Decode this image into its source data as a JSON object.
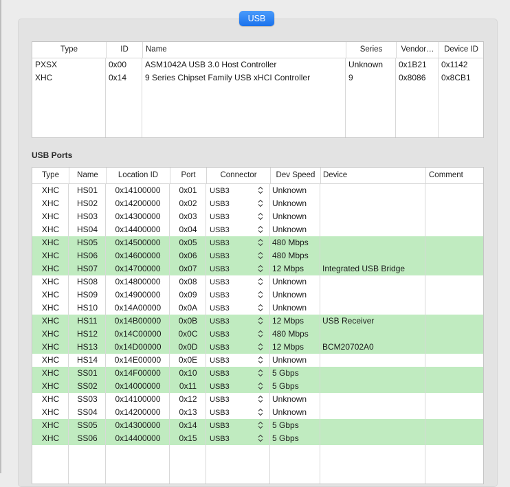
{
  "tab": {
    "label": "USB"
  },
  "controllers": {
    "columns": [
      "Type",
      "ID",
      "Name",
      "Series",
      "Vendor…",
      "Device ID"
    ],
    "rows": [
      {
        "type": "PXSX",
        "id": "0x00",
        "name": "ASM1042A USB 3.0 Host Controller",
        "series": "Unknown",
        "vendor": "0x1B21",
        "device_id": "0x1142"
      },
      {
        "type": "XHC",
        "id": "0x14",
        "name": "9 Series Chipset Family USB xHCI Controller",
        "series": "9",
        "vendor": "0x8086",
        "device_id": "0x8CB1"
      }
    ]
  },
  "ports_label": "USB Ports",
  "ports": {
    "columns": [
      "Type",
      "Name",
      "Location ID",
      "Port",
      "Connector",
      "Dev Speed",
      "Device",
      "Comment"
    ],
    "highlight_color": "#c0ebc0",
    "rows": [
      {
        "type": "XHC",
        "name": "HS01",
        "location": "0x14100000",
        "port": "0x01",
        "connector": "USB3",
        "speed": "Unknown",
        "device": "",
        "comment": "",
        "active": false
      },
      {
        "type": "XHC",
        "name": "HS02",
        "location": "0x14200000",
        "port": "0x02",
        "connector": "USB3",
        "speed": "Unknown",
        "device": "",
        "comment": "",
        "active": false
      },
      {
        "type": "XHC",
        "name": "HS03",
        "location": "0x14300000",
        "port": "0x03",
        "connector": "USB3",
        "speed": "Unknown",
        "device": "",
        "comment": "",
        "active": false
      },
      {
        "type": "XHC",
        "name": "HS04",
        "location": "0x14400000",
        "port": "0x04",
        "connector": "USB3",
        "speed": "Unknown",
        "device": "",
        "comment": "",
        "active": false
      },
      {
        "type": "XHC",
        "name": "HS05",
        "location": "0x14500000",
        "port": "0x05",
        "connector": "USB3",
        "speed": "480 Mbps",
        "device": "",
        "comment": "",
        "active": true
      },
      {
        "type": "XHC",
        "name": "HS06",
        "location": "0x14600000",
        "port": "0x06",
        "connector": "USB3",
        "speed": "480 Mbps",
        "device": "",
        "comment": "",
        "active": true
      },
      {
        "type": "XHC",
        "name": "HS07",
        "location": "0x14700000",
        "port": "0x07",
        "connector": "USB3",
        "speed": "12 Mbps",
        "device": "Integrated USB Bridge",
        "comment": "",
        "active": true
      },
      {
        "type": "XHC",
        "name": "HS08",
        "location": "0x14800000",
        "port": "0x08",
        "connector": "USB3",
        "speed": "Unknown",
        "device": "",
        "comment": "",
        "active": false
      },
      {
        "type": "XHC",
        "name": "HS09",
        "location": "0x14900000",
        "port": "0x09",
        "connector": "USB3",
        "speed": "Unknown",
        "device": "",
        "comment": "",
        "active": false
      },
      {
        "type": "XHC",
        "name": "HS10",
        "location": "0x14A00000",
        "port": "0x0A",
        "connector": "USB3",
        "speed": "Unknown",
        "device": "",
        "comment": "",
        "active": false
      },
      {
        "type": "XHC",
        "name": "HS11",
        "location": "0x14B00000",
        "port": "0x0B",
        "connector": "USB3",
        "speed": "12 Mbps",
        "device": "USB Receiver",
        "comment": "",
        "active": true
      },
      {
        "type": "XHC",
        "name": "HS12",
        "location": "0x14C00000",
        "port": "0x0C",
        "connector": "USB3",
        "speed": "480 Mbps",
        "device": "",
        "comment": "",
        "active": true
      },
      {
        "type": "XHC",
        "name": "HS13",
        "location": "0x14D00000",
        "port": "0x0D",
        "connector": "USB3",
        "speed": "12 Mbps",
        "device": "BCM20702A0",
        "comment": "",
        "active": true
      },
      {
        "type": "XHC",
        "name": "HS14",
        "location": "0x14E00000",
        "port": "0x0E",
        "connector": "USB3",
        "speed": "Unknown",
        "device": "",
        "comment": "",
        "active": false
      },
      {
        "type": "XHC",
        "name": "SS01",
        "location": "0x14F00000",
        "port": "0x10",
        "connector": "USB3",
        "speed": "5 Gbps",
        "device": "",
        "comment": "",
        "active": true
      },
      {
        "type": "XHC",
        "name": "SS02",
        "location": "0x14000000",
        "port": "0x11",
        "connector": "USB3",
        "speed": "5 Gbps",
        "device": "",
        "comment": "",
        "active": true
      },
      {
        "type": "XHC",
        "name": "SS03",
        "location": "0x14100000",
        "port": "0x12",
        "connector": "USB3",
        "speed": "Unknown",
        "device": "",
        "comment": "",
        "active": false
      },
      {
        "type": "XHC",
        "name": "SS04",
        "location": "0x14200000",
        "port": "0x13",
        "connector": "USB3",
        "speed": "Unknown",
        "device": "",
        "comment": "",
        "active": false
      },
      {
        "type": "XHC",
        "name": "SS05",
        "location": "0x14300000",
        "port": "0x14",
        "connector": "USB3",
        "speed": "5 Gbps",
        "device": "",
        "comment": "",
        "active": true
      },
      {
        "type": "XHC",
        "name": "SS06",
        "location": "0x14400000",
        "port": "0x15",
        "connector": "USB3",
        "speed": "5 Gbps",
        "device": "",
        "comment": "",
        "active": true
      }
    ]
  }
}
